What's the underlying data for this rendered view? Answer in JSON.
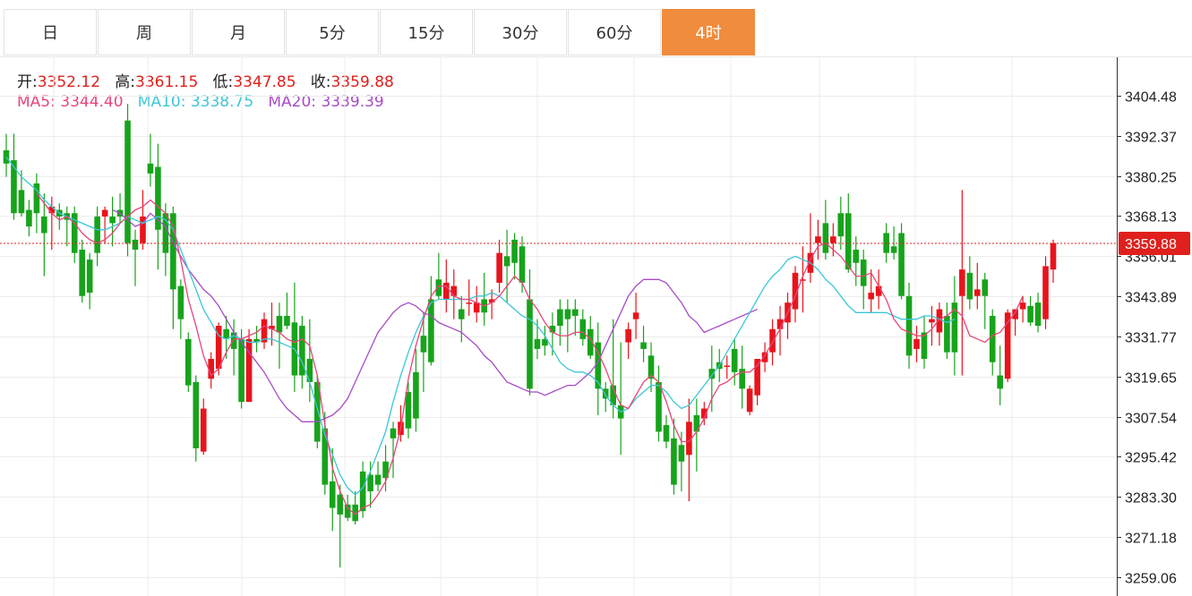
{
  "tabs": [
    {
      "label": "日",
      "active": false
    },
    {
      "label": "周",
      "active": false
    },
    {
      "label": "月",
      "active": false
    },
    {
      "label": "5分",
      "active": false
    },
    {
      "label": "15分",
      "active": false
    },
    {
      "label": "30分",
      "active": false
    },
    {
      "label": "60分",
      "active": false
    },
    {
      "label": "4时",
      "active": true
    }
  ],
  "ohlc": {
    "open_label": "开:",
    "open": "3352.12",
    "high_label": "高:",
    "high": "3361.15",
    "low_label": "低:",
    "low": "3347.85",
    "close_label": "收:",
    "close": "3359.88"
  },
  "ma": {
    "ma5_label": "MA5:",
    "ma5": "3344.40",
    "ma10_label": "MA10:",
    "ma10": "3338.75",
    "ma20_label": "MA20:",
    "ma20": "3339.39"
  },
  "colors": {
    "up": "#e8141c",
    "down": "#17a31b",
    "ma5": "#e8457a",
    "ma10": "#3cc6d6",
    "ma20": "#a84bc7",
    "accent": "#f08c3e",
    "price_line": "#e0201c"
  },
  "chart_data": {
    "type": "candlestick",
    "y_ticks": [
      "3404.48",
      "3392.37",
      "3380.25",
      "3368.13",
      "3356.01",
      "3343.89",
      "3331.77",
      "3319.65",
      "3307.54",
      "3295.42",
      "3283.30",
      "3271.18",
      "3259.06"
    ],
    "ylim": [
      3256,
      3412
    ],
    "current_price": 3359.88,
    "grid": true,
    "candles": [
      [
        3388,
        3393,
        3380,
        3384
      ],
      [
        3385,
        3393,
        3367,
        3369
      ],
      [
        3376,
        3382,
        3368,
        3369
      ],
      [
        3370,
        3373,
        3362,
        3365
      ],
      [
        3378,
        3381,
        3363,
        3369
      ],
      [
        3368,
        3375,
        3350,
        3363
      ],
      [
        3369,
        3374,
        3358,
        3371
      ],
      [
        3370,
        3372,
        3364,
        3368
      ],
      [
        3369,
        3371,
        3359,
        3367
      ],
      [
        3369,
        3371,
        3354,
        3357
      ],
      [
        3358,
        3361,
        3342,
        3344
      ],
      [
        3355,
        3357,
        3340,
        3345
      ],
      [
        3368,
        3371,
        3353,
        3357
      ],
      [
        3368,
        3371,
        3360,
        3370
      ],
      [
        3368,
        3374,
        3359,
        3366
      ],
      [
        3370,
        3375,
        3366,
        3368
      ],
      [
        3397,
        3402,
        3356,
        3360
      ],
      [
        3361,
        3364,
        3347,
        3358
      ],
      [
        3360,
        3376,
        3358,
        3368
      ],
      [
        3384,
        3393,
        3377,
        3381
      ],
      [
        3383,
        3390,
        3352,
        3364
      ],
      [
        3369,
        3372,
        3350,
        3357
      ],
      [
        3369,
        3371,
        3334,
        3346
      ],
      [
        3347,
        3349,
        3331,
        3337
      ],
      [
        3331,
        3333,
        3315,
        3317
      ],
      [
        3318,
        3320,
        3294,
        3298
      ],
      [
        3297,
        3313,
        3296,
        3310
      ],
      [
        3319,
        3327,
        3316,
        3325
      ],
      [
        3322,
        3336,
        3320,
        3335
      ],
      [
        3334,
        3338,
        3325,
        3331
      ],
      [
        3333,
        3337,
        3320,
        3328
      ],
      [
        3331,
        3334,
        3310,
        3312
      ],
      [
        3312,
        3334,
        3312,
        3331
      ],
      [
        3331,
        3335,
        3327,
        3330
      ],
      [
        3330,
        3339,
        3328,
        3337
      ],
      [
        3334,
        3342,
        3329,
        3335
      ],
      [
        3338,
        3342,
        3322,
        3333
      ],
      [
        3338,
        3345,
        3334,
        3335
      ],
      [
        3336,
        3348,
        3315,
        3320
      ],
      [
        3335,
        3338,
        3316,
        3320
      ],
      [
        3325,
        3337,
        3312,
        3318
      ],
      [
        3318,
        3320,
        3298,
        3300
      ],
      [
        3304,
        3309,
        3284,
        3287
      ],
      [
        3288,
        3298,
        3273,
        3280
      ],
      [
        3284,
        3287,
        3262,
        3278
      ],
      [
        3281,
        3284,
        3276,
        3277
      ],
      [
        3281,
        3285,
        3275,
        3276
      ],
      [
        3291,
        3294,
        3277,
        3279
      ],
      [
        3290,
        3294,
        3280,
        3285
      ],
      [
        3290,
        3294,
        3285,
        3287
      ],
      [
        3294,
        3299,
        3285,
        3289
      ],
      [
        3304,
        3306,
        3289,
        3301
      ],
      [
        3302,
        3311,
        3300,
        3306
      ],
      [
        3315,
        3318,
        3301,
        3304
      ],
      [
        3321,
        3328,
        3303,
        3307
      ],
      [
        3332,
        3339,
        3315,
        3327
      ],
      [
        3343,
        3350,
        3323,
        3324
      ],
      [
        3349,
        3357,
        3343,
        3344
      ],
      [
        3343,
        3355,
        3339,
        3348
      ],
      [
        3344,
        3352,
        3337,
        3347
      ],
      [
        3340,
        3344,
        3330,
        3337
      ],
      [
        3342,
        3349,
        3338,
        3342
      ],
      [
        3339,
        3347,
        3336,
        3342
      ],
      [
        3343,
        3351,
        3335,
        3339
      ],
      [
        3342,
        3346,
        3337,
        3343
      ],
      [
        3348,
        3361,
        3345,
        3357
      ],
      [
        3356,
        3364,
        3342,
        3353
      ],
      [
        3361,
        3363,
        3349,
        3354
      ],
      [
        3359,
        3362,
        3345,
        3348
      ],
      [
        3343,
        3352,
        3314,
        3316
      ],
      [
        3331,
        3337,
        3325,
        3328
      ],
      [
        3331,
        3335,
        3326,
        3329
      ],
      [
        3335,
        3339,
        3326,
        3333
      ],
      [
        3340,
        3343,
        3329,
        3335
      ],
      [
        3340,
        3343,
        3327,
        3337
      ],
      [
        3340,
        3343,
        3332,
        3338
      ],
      [
        3337,
        3340,
        3329,
        3331
      ],
      [
        3334,
        3338,
        3325,
        3326
      ],
      [
        3330,
        3336,
        3308,
        3316
      ],
      [
        3316,
        3318,
        3309,
        3313
      ],
      [
        3317,
        3337,
        3307,
        3311
      ],
      [
        3311,
        3330,
        3296,
        3307
      ],
      [
        3330,
        3336,
        3325,
        3334
      ],
      [
        3337,
        3345,
        3331,
        3339
      ],
      [
        3330,
        3335,
        3324,
        3328
      ],
      [
        3326,
        3330,
        3315,
        3319
      ],
      [
        3318,
        3323,
        3300,
        3303
      ],
      [
        3305,
        3308,
        3298,
        3300
      ],
      [
        3301,
        3307,
        3284,
        3287
      ],
      [
        3299,
        3303,
        3285,
        3294
      ],
      [
        3296,
        3313,
        3282,
        3306
      ],
      [
        3308,
        3313,
        3291,
        3303
      ],
      [
        3307,
        3312,
        3305,
        3310
      ],
      [
        3322,
        3329,
        3309,
        3319
      ],
      [
        3324,
        3328,
        3318,
        3322
      ],
      [
        3323,
        3326,
        3319,
        3323
      ],
      [
        3328,
        3331,
        3317,
        3321
      ],
      [
        3322,
        3329,
        3310,
        3316
      ],
      [
        3309,
        3317,
        3308,
        3316
      ],
      [
        3314,
        3324,
        3311,
        3325
      ],
      [
        3324,
        3330,
        3321,
        3327
      ],
      [
        3327,
        3337,
        3323,
        3334
      ],
      [
        3334,
        3341,
        3326,
        3337
      ],
      [
        3336,
        3345,
        3331,
        3342
      ],
      [
        3340,
        3353,
        3336,
        3351
      ],
      [
        3349,
        3359,
        3339,
        3349
      ],
      [
        3351,
        3369,
        3348,
        3357
      ],
      [
        3360,
        3367,
        3355,
        3362
      ],
      [
        3366,
        3373,
        3355,
        3357
      ],
      [
        3360,
        3366,
        3356,
        3362
      ],
      [
        3369,
        3374,
        3358,
        3362
      ],
      [
        3369,
        3375,
        3351,
        3352
      ],
      [
        3358,
        3362,
        3347,
        3354
      ],
      [
        3355,
        3358,
        3340,
        3347
      ],
      [
        3343,
        3352,
        3339,
        3345
      ],
      [
        3344,
        3352,
        3340,
        3347
      ],
      [
        3363,
        3366,
        3354,
        3357
      ],
      [
        3359,
        3365,
        3355,
        3357
      ],
      [
        3363,
        3366,
        3343,
        3344
      ],
      [
        3344,
        3348,
        3322,
        3326
      ],
      [
        3328,
        3335,
        3324,
        3331
      ],
      [
        3333,
        3338,
        3322,
        3325
      ],
      [
        3336,
        3341,
        3329,
        3337
      ],
      [
        3333,
        3342,
        3329,
        3340
      ],
      [
        3338,
        3342,
        3325,
        3327
      ],
      [
        3342,
        3350,
        3320,
        3327
      ],
      [
        3344,
        3376,
        3320,
        3352
      ],
      [
        3351,
        3356,
        3340,
        3343
      ],
      [
        3344,
        3354,
        3340,
        3346
      ],
      [
        3349,
        3351,
        3334,
        3344
      ],
      [
        3338,
        3340,
        3320,
        3324
      ],
      [
        3320,
        3329,
        3311,
        3316
      ],
      [
        3319,
        3340,
        3318,
        3339
      ],
      [
        3337,
        3340,
        3332,
        3340
      ],
      [
        3340,
        3344,
        3336,
        3342
      ],
      [
        3341,
        3344,
        3335,
        3336
      ],
      [
        3342,
        3345,
        3333,
        3335
      ],
      [
        3337,
        3356,
        3334,
        3353
      ],
      [
        3352,
        3361,
        3348,
        3360
      ]
    ],
    "ma5": [
      null,
      null,
      null,
      null,
      3375,
      3372,
      3369,
      3367,
      3368,
      3366,
      3363,
      3361,
      3360,
      3361,
      3363,
      3366,
      3368,
      3370,
      3371,
      3373,
      3371,
      3369,
      3365,
      3355,
      3343,
      3335,
      3326,
      3320,
      3322,
      3327,
      3331,
      3331,
      3332,
      3333,
      3335,
      3334,
      3333,
      3331,
      3330,
      3331,
      3329,
      3320,
      3305,
      3292,
      3285,
      3280,
      3278,
      3280,
      3281,
      3284,
      3288,
      3295,
      3304,
      3319,
      3329,
      3337,
      3344,
      3347,
      3347,
      3344,
      3343,
      3343,
      3342,
      3341,
      3342,
      3344,
      3347,
      3350,
      3348,
      3343,
      3340,
      3336,
      3333,
      3332,
      3332,
      3333,
      3333,
      3331,
      3327,
      3322,
      3316,
      3311,
      3310,
      3314,
      3318,
      3320,
      3318,
      3312,
      3305,
      3300,
      3300,
      3303,
      3307,
      3313,
      3317,
      3318,
      3320,
      3321,
      3321,
      3323,
      3326,
      3330,
      3334,
      3339,
      3344,
      3350,
      3355,
      3359,
      3360,
      3358,
      3356,
      3353,
      3350,
      3350,
      3351,
      3347,
      3343,
      3337,
      3334,
      3333,
      3332,
      3332,
      3334,
      3337,
      3338,
      3340,
      3338,
      3332,
      3331,
      3330,
      3332,
      3333,
      3336,
      3339,
      3344
    ],
    "ma10": [
      3386,
      3383,
      3380,
      3378,
      3376,
      3373,
      3371,
      3369,
      3368,
      3367,
      3366,
      3365,
      3364,
      3364,
      3365,
      3366,
      3368,
      3367,
      3366,
      3367,
      3368,
      3367,
      3364,
      3358,
      3352,
      3346,
      3340,
      3336,
      3332,
      3331,
      3332,
      3331,
      3330,
      3330,
      3331,
      3331,
      3330,
      3329,
      3328,
      3324,
      3318,
      3310,
      3302,
      3296,
      3290,
      3286,
      3284,
      3286,
      3291,
      3297,
      3303,
      3312,
      3320,
      3327,
      3333,
      3338,
      3342,
      3343,
      3343,
      3343,
      3343,
      3343,
      3344,
      3344,
      3345,
      3344,
      3342,
      3340,
      3338,
      3337,
      3335,
      3332,
      3328,
      3324,
      3322,
      3321,
      3321,
      3320,
      3318,
      3314,
      3311,
      3309,
      3310,
      3313,
      3315,
      3317,
      3317,
      3315,
      3312,
      3310,
      3311,
      3314,
      3317,
      3320,
      3323,
      3327,
      3331,
      3335,
      3339,
      3343,
      3347,
      3350,
      3352,
      3355,
      3356,
      3355,
      3354,
      3352,
      3349,
      3347,
      3344,
      3341,
      3339,
      3339,
      3339,
      3339,
      3339,
      3338,
      3337,
      3337,
      3337,
      3338,
      3338,
      3337,
      3336,
      3337
    ],
    "ma20": [
      null,
      null,
      null,
      null,
      null,
      null,
      null,
      null,
      null,
      null,
      null,
      null,
      null,
      null,
      3370,
      3369,
      3367,
      3365,
      3366,
      3369,
      3367,
      3365,
      3360,
      3356,
      3352,
      3349,
      3346,
      3344,
      3341,
      3337,
      3333,
      3330,
      3327,
      3324,
      3321,
      3317,
      3313,
      3310,
      3308,
      3306,
      3306,
      3306,
      3307,
      3308,
      3310,
      3313,
      3318,
      3323,
      3328,
      3333,
      3336,
      3339,
      3341,
      3342,
      3341,
      3339,
      3338,
      3336,
      3335,
      3334,
      3333,
      3331,
      3329,
      3326,
      3324,
      3321,
      3318,
      3317,
      3316,
      3315,
      3315,
      3314,
      3315,
      3316,
      3317,
      3317,
      3319,
      3321,
      3324,
      3329,
      3334,
      3339,
      3344,
      3347,
      3349,
      3349,
      3349,
      3348,
      3345,
      3342,
      3338,
      3336,
      3333,
      3334,
      3335,
      3336,
      3337,
      3338,
      3339,
      3340
    ]
  }
}
